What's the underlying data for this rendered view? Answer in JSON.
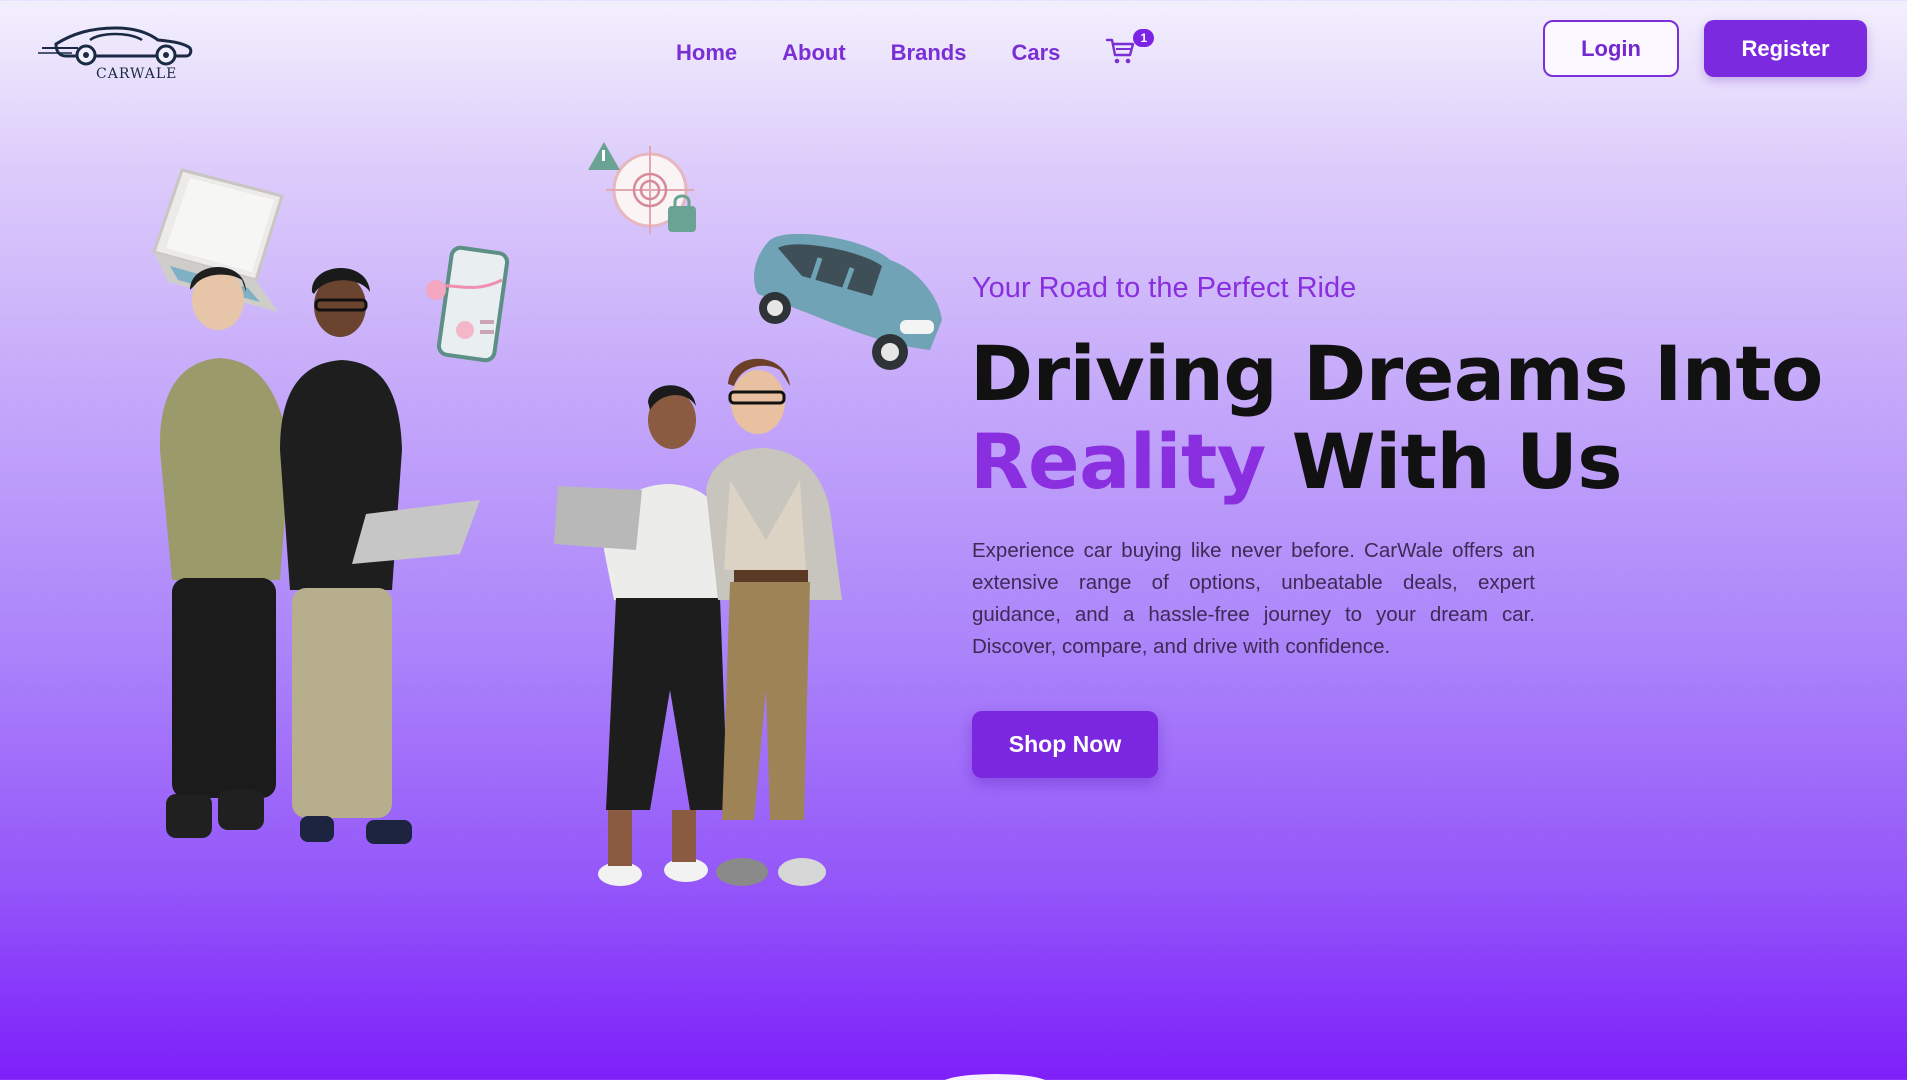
{
  "brand": {
    "name": "CARWALE",
    "logo_icon": "car-logo-icon"
  },
  "nav": {
    "links": [
      "Home",
      "About",
      "Brands",
      "Cars"
    ],
    "cart_icon": "cart-icon",
    "cart_count": "1"
  },
  "auth": {
    "login_label": "Login",
    "register_label": "Register"
  },
  "hero": {
    "tagline": "Your Road to the Perfect Ride",
    "headline_line1": "Driving Dreams Into",
    "headline_accent": "Reality",
    "headline_rest": " With Us",
    "description": "Experience car buying like never before. CarWale offers an extensive range of options, unbeatable deals, expert guidance, and a hassle-free journey to your dream car. Discover, compare, and drive with confidence.",
    "cta_label": "Shop Now"
  },
  "colors": {
    "accent": "#8a2fe0",
    "button": "#7a27df",
    "headline": "#111111",
    "background_top": "#f3f0fd",
    "background_bottom": "#7d1ffa"
  }
}
